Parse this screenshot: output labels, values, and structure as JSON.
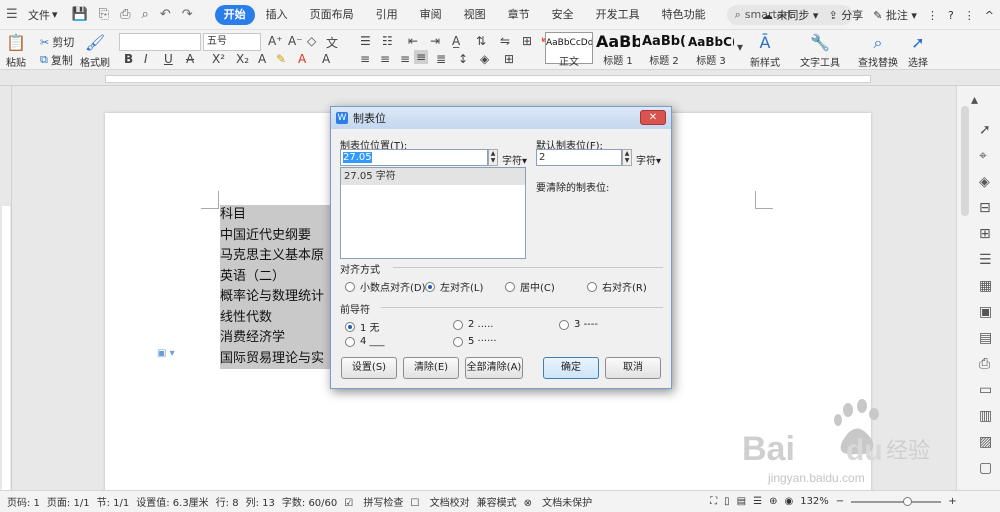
{
  "menubar": {
    "file": "文件",
    "tabs": [
      "开始",
      "插入",
      "页面布局",
      "引用",
      "审阅",
      "视图",
      "章节",
      "安全",
      "开发工具",
      "特色功能"
    ],
    "active_tab": "开始",
    "search": "smartart",
    "unsync": "未同步",
    "share": "分享",
    "comment": "批注"
  },
  "toolbar": {
    "paste": "粘贴",
    "cut": "剪切",
    "copy": "复制",
    "format_painter": "格式刷",
    "font_name": "",
    "font_size": "五号",
    "bold": "B",
    "italic": "I",
    "underline": "U",
    "font_color": "A",
    "styles": [
      {
        "preview": "AaBbCcDd",
        "name": "正文"
      },
      {
        "preview": "AaBb",
        "name": "标题 1"
      },
      {
        "preview": "AaBb(",
        "name": "标题 2"
      },
      {
        "preview": "AaBbC(",
        "name": "标题 3"
      }
    ],
    "new_style": "新样式",
    "text_tools": "文字工具",
    "find_replace": "查找替换",
    "select": "选择"
  },
  "document": {
    "lines": [
      "科目",
      "中国近代史纲要",
      "马克思主义基本原",
      "英语（二）",
      "概率论与数理统计",
      "线性代数",
      "消费经济学",
      "国际贸易理论与实"
    ]
  },
  "dialog": {
    "title": "制表位",
    "tab_pos_label": "制表位位置(T):",
    "tab_pos_value": "27.05",
    "unit1": "字符",
    "default_label": "默认制表位(F):",
    "default_value": "2",
    "unit2": "字符",
    "list_items": [
      "27.05 字符"
    ],
    "clear_label": "要清除的制表位:",
    "align_title": "对齐方式",
    "align_options": [
      "小数点对齐(D)",
      "左对齐(L)",
      "居中(C)",
      "右对齐(R)"
    ],
    "leader_title": "前导符",
    "leader_options": [
      "1 无",
      "2 .....",
      "3 ----",
      "4 ___",
      "5 ······"
    ],
    "buttons": [
      "设置(S)",
      "清除(E)",
      "全部清除(A)",
      "确定",
      "取消"
    ]
  },
  "statusbar": {
    "items": [
      "页码: 1",
      "页面: 1/1",
      "节: 1/1",
      "设置值: 6.3厘米",
      "行: 8",
      "列: 13",
      "字数: 60/60",
      "拼写检查",
      "文档校对",
      "兼容模式",
      "文档未保护"
    ],
    "zoom": "132%"
  },
  "watermark": {
    "brand": "Bai",
    "brand2": "du",
    "cn": "经验",
    "url": "jingyan.baidu.com"
  }
}
